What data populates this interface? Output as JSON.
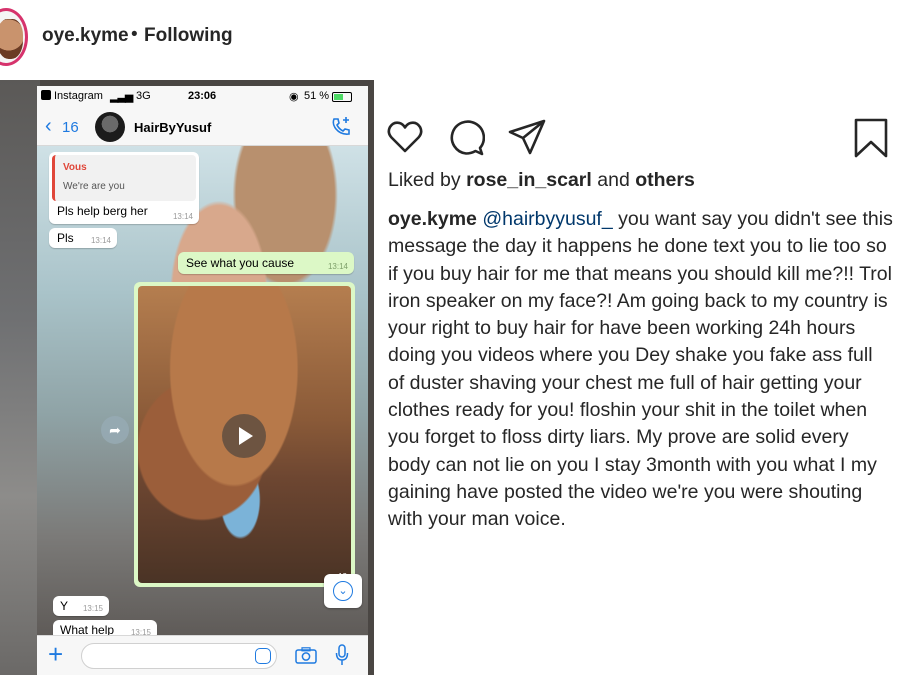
{
  "header": {
    "username": "oye.kyme",
    "separator": "•",
    "follow_status": "Following"
  },
  "media": {
    "status_bar": {
      "app": "Instagram",
      "network": "3G",
      "time": "23:06",
      "battery": "51 %"
    },
    "chat": {
      "back_count": "16",
      "contact_name": "HairByYusuf",
      "reply_author": "Vous",
      "reply_text": "We're are you",
      "messages": [
        {
          "text": "Pls help berg her",
          "time": "13:14",
          "direction": "in"
        },
        {
          "text": "Pls",
          "time": "13:14",
          "direction": "in"
        },
        {
          "text": "See what you cause",
          "time": "13:14",
          "direction": "out"
        },
        {
          "text": "Y",
          "time": "13:15",
          "direction": "in"
        },
        {
          "text": "What help",
          "time": "13:15",
          "direction": "in"
        }
      ],
      "video_time": "13"
    }
  },
  "actions": {
    "icons": [
      "heart-icon",
      "comment-icon",
      "share-icon",
      "bookmark-icon"
    ]
  },
  "likes": {
    "prefix": "Liked by",
    "user": "rose_in_scarl",
    "middle": "and",
    "others": "others"
  },
  "caption": {
    "username": "oye.kyme",
    "mention": "@hairbyyusuf_",
    "text": " you want say you didn't see this message the day it happens he done text you to lie too so if you buy hair for me that means you should kill me?!! Trol iron speaker on my face?! Am going back to my country is your right to buy hair for have been working 24h hours doing you videos where you Dey shake you fake ass full of duster shaving your chest me full of hair getting your clothes ready for you! floshin your shit in the toilet when you forget to floss dirty liars. My prove are solid every body can not lie on you I stay 3month with you what I my gaining have posted the video we're you were shouting with your man voice."
  },
  "colors": {
    "accent_blue": "#1f7ae0",
    "mention_blue": "#00376b",
    "whatsapp_out": "#dcf8c6",
    "reply_red": "#e0473a",
    "story_ring": "#d6336c"
  }
}
